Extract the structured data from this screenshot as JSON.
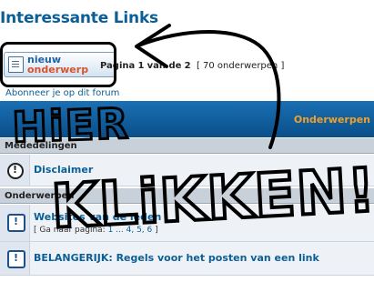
{
  "page": {
    "title": "Interessante Links",
    "subscribe_link": "Abonneer je op dit forum"
  },
  "new_topic_button": {
    "line1": "nieuw",
    "line2": "onderwerp",
    "icon": "document-icon"
  },
  "pagination": {
    "prefix": "Pagina",
    "current": "1",
    "of_text": "van de",
    "total": "2",
    "count_text": "[ 70 onderwerpen ]"
  },
  "table": {
    "header_column": "Onderwerpen",
    "sections": [
      {
        "label": "Mededelingen",
        "topics": [
          {
            "icon": "announcement-icon",
            "title": "Disclaimer",
            "pages": ""
          }
        ]
      },
      {
        "label": "Onderwerpen",
        "topics": [
          {
            "icon": "sticky-topic-icon",
            "title": "Websites van de leden",
            "pages_prefix": "[ Ga naar pagina:",
            "pages_links": "1 ... 4, 5, 6",
            "pages_suffix": "]"
          },
          {
            "icon": "sticky-topic-icon",
            "title": "BELANGERIJK: Regels voor het posten van een link",
            "pages": ""
          }
        ]
      }
    ]
  },
  "annotation": {
    "word1": "HiER",
    "word2": "KLiKKEN!",
    "color": "#000000"
  }
}
